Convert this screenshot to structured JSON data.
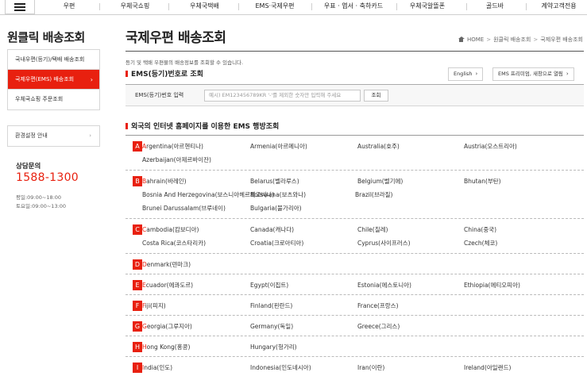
{
  "topnav": {
    "items": [
      "우편",
      "우체국쇼핑",
      "우체국택배",
      "EMS·국제우편",
      "우표 · 엽서 · 축하카드",
      "우체국알뜰폰",
      "골드바",
      "계약고객전용"
    ]
  },
  "sidebar": {
    "title": "원클릭 배송조회",
    "items": [
      {
        "label": "국내우편(등기)/택배 배송조회"
      },
      {
        "label": "국제우편(EMS) 배송조회",
        "arrow": "›"
      },
      {
        "label": "우체국쇼핑 주문조회"
      }
    ],
    "env": {
      "label": "환경설정 안내",
      "arrow": "›"
    },
    "consult": {
      "label": "상담문의",
      "phone": "1588-1300",
      "weekday": "평일:09:00~18:00",
      "saturday": "토요일:09:00~13:00"
    }
  },
  "main": {
    "title": "국제우편 배송조회",
    "breadcrumb": [
      "HOME",
      "원클릭 배송조회",
      "국제우편 배송조회"
    ],
    "breadcrumb_sep": ">",
    "description": "등기 및 택배 우편물의 배송정보를 조회할 수 있습니다.",
    "section1": "EMS(등기)번호로 조회",
    "english_btn": "English",
    "premium_btn": "EMS 프리미엄, 새창으로 열림",
    "btn_arrow": "›",
    "search": {
      "label": "EMS(등기)번호 입력",
      "placeholder": "예시) EM123456789KR '-'를 제외한 숫자만 입력해 주세요",
      "button": "조회"
    },
    "section2": "외국의 인터넷 홈페이지를 이용한 EMS 행방조회"
  },
  "countries": [
    {
      "letter": "A",
      "rows": [
        [
          "Argentina(아르헨티나)",
          "Armenia(아르메니아)",
          "Australia(호주)",
          "Austria(오스트리아)"
        ],
        [
          "Azerbaijan(아제르바이잔)"
        ]
      ]
    },
    {
      "letter": "B",
      "rows": [
        [
          "Bahrain(바레인)",
          "Belarus(벨라루스)",
          "Belgium(벨기에)",
          "Bhutan(부탄)"
        ],
        [
          "Bosnia And Herzegovina(보스니아헤르체고비나)",
          "Botswana(보츠와나)",
          "Brazil(브라질)"
        ],
        [
          "Brunei Darussalam(브루네이)",
          "Bulgaria(불가리아)"
        ]
      ]
    },
    {
      "letter": "C",
      "rows": [
        [
          "Cambodia(캄보디아)",
          "Canada(캐나다)",
          "Chile(칠레)",
          "China(중국)"
        ],
        [
          "Costa Rica(코스타리카)",
          "Croatia(크로아티아)",
          "Cyprus(사이프러스)",
          "Czech(체코)"
        ]
      ]
    },
    {
      "letter": "D",
      "rows": [
        [
          "Denmark(덴마크)"
        ]
      ]
    },
    {
      "letter": "E",
      "rows": [
        [
          "Ecuador(에콰도르)",
          "Egypt(이집트)",
          "Estonia(에스토니아)",
          "Ethiopia(에티오피아)"
        ]
      ]
    },
    {
      "letter": "F",
      "rows": [
        [
          "Fiji(피지)",
          "Finland(핀란드)",
          "France(프랑스)"
        ]
      ]
    },
    {
      "letter": "G",
      "rows": [
        [
          "Georgia(그루지아)",
          "Germany(독일)",
          "Greece(그리스)"
        ]
      ]
    },
    {
      "letter": "H",
      "rows": [
        [
          "Hong Kong(홍콩)",
          "Hungary(헝가리)"
        ]
      ]
    },
    {
      "letter": "I",
      "rows": [
        [
          "India(인도)",
          "Indonesia(인도네시아)",
          "Iran(이란)",
          "Ireland(아일랜드)"
        ]
      ]
    }
  ]
}
